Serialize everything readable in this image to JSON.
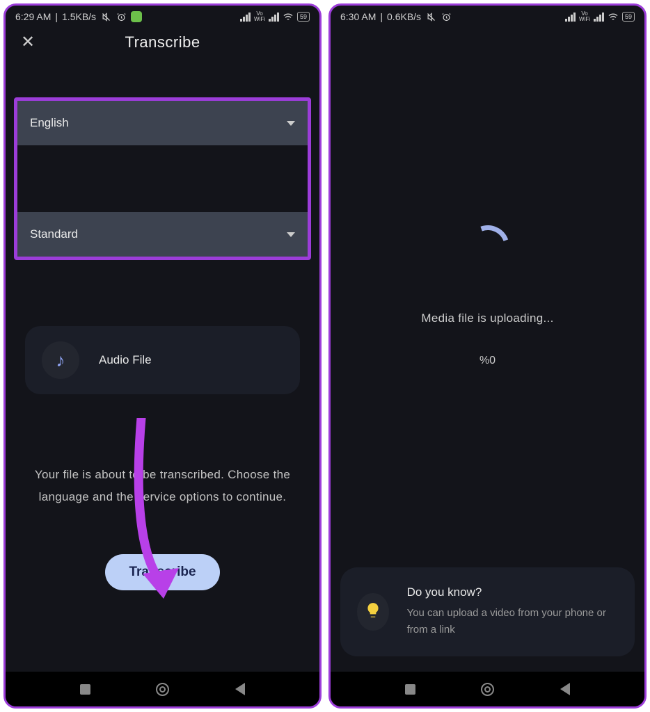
{
  "left": {
    "status": {
      "time": "6:29 AM",
      "net": "1.5KB/s",
      "battery": "59"
    },
    "appbar": {
      "title": "Transcribe"
    },
    "dropdowns": {
      "language": "English",
      "mode": "Standard"
    },
    "file": {
      "label": "Audio File"
    },
    "info": "Your file is about to be transcribed. Choose the language and the service options to continue.",
    "button": "Transcribe"
  },
  "right": {
    "status": {
      "time": "6:30 AM",
      "net": "0.6KB/s",
      "battery": "59"
    },
    "upload": {
      "text": "Media file is uploading...",
      "pct": "%0"
    },
    "tip": {
      "title": "Do you know?",
      "body": "You can upload a video from your phone or from a link"
    }
  }
}
